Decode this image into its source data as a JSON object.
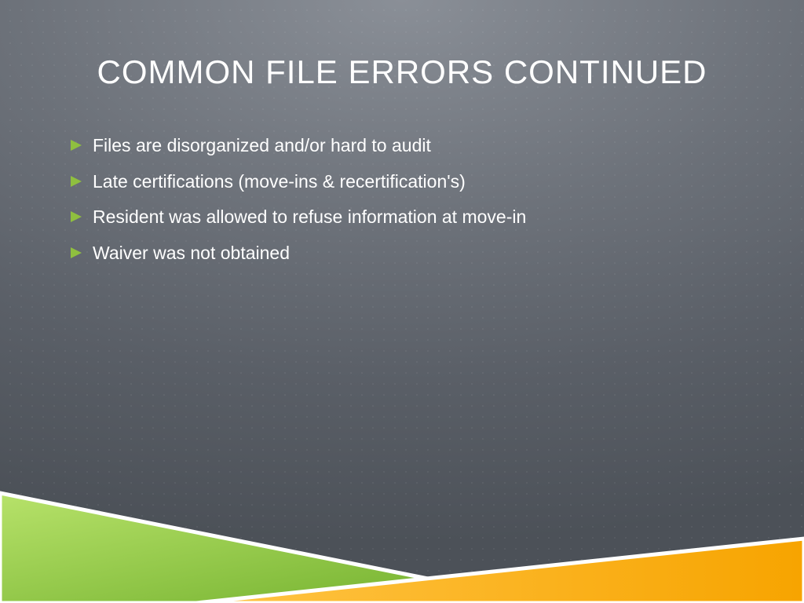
{
  "title": "COMMON FILE ERRORS CONTINUED",
  "bullets": [
    "Files are disorganized and/or hard to audit",
    "Late certifications (move-ins & recertification's)",
    "Resident was allowed to refuse information at move-in",
    "Waiver was not obtained"
  ],
  "colors": {
    "bullet_accent": "#8fbf3f",
    "footer_green_light": "#b7e26a",
    "footer_green_dark": "#6fae2a",
    "footer_orange_light": "#ffc546",
    "footer_orange_dark": "#f7a400",
    "footer_stroke": "#ffffff"
  }
}
